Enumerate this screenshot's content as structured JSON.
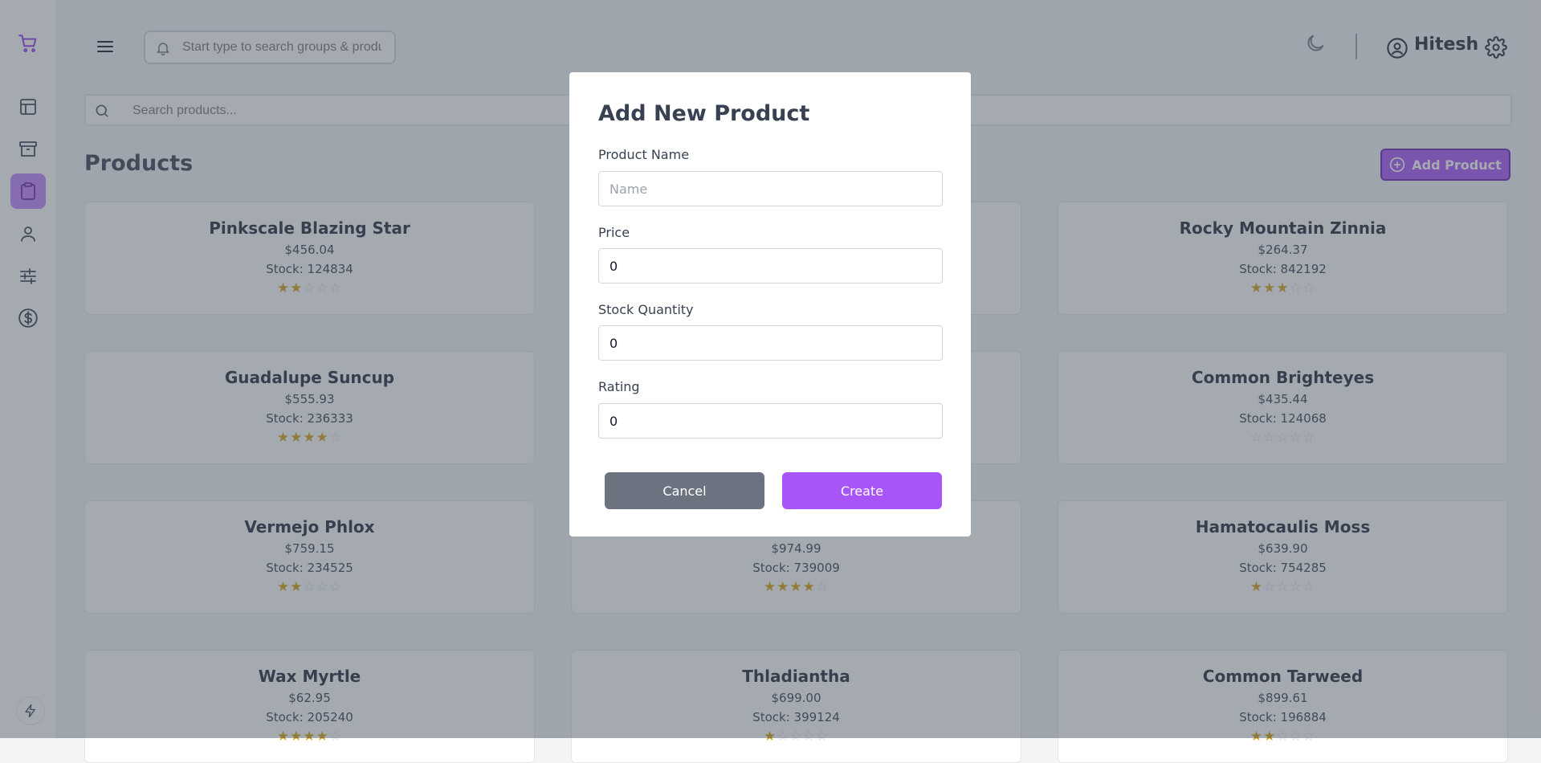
{
  "sidebar": {
    "items": [
      {
        "icon": "shopping-cart-icon"
      },
      {
        "icon": "dashboard-layout-icon"
      },
      {
        "icon": "archive-box-icon"
      },
      {
        "icon": "clipboard-icon"
      },
      {
        "icon": "user-icon"
      },
      {
        "icon": "sliders-icon"
      },
      {
        "icon": "dollar-circle-icon"
      }
    ],
    "bottom_icon": "lightning-icon"
  },
  "header": {
    "search_placeholder": "Start type to search groups & products",
    "username": "Hitesh"
  },
  "products_page": {
    "search_placeholder": "Search products...",
    "title": "Products",
    "add_button_label": "Add Product",
    "products": [
      {
        "name": "Pinkscale Blazing Star",
        "price": "$456.04",
        "stock": "Stock: 124834",
        "rating": 2
      },
      {
        "name": "",
        "price": "",
        "stock": "",
        "rating": 0
      },
      {
        "name": "Rocky Mountain Zinnia",
        "price": "$264.37",
        "stock": "Stock: 842192",
        "rating": 3
      },
      {
        "name": "Guadalupe Suncup",
        "price": "$555.93",
        "stock": "Stock: 236333",
        "rating": 4
      },
      {
        "name": "",
        "price": "",
        "stock": "",
        "rating": 0
      },
      {
        "name": "Common Brighteyes",
        "price": "$435.44",
        "stock": "Stock: 124068",
        "rating": 0
      },
      {
        "name": "Vermejo Phlox",
        "price": "$759.15",
        "stock": "Stock: 234525",
        "rating": 2
      },
      {
        "name": "",
        "price": "$974.99",
        "stock": "Stock: 739009",
        "rating": 4
      },
      {
        "name": "Hamatocaulis Moss",
        "price": "$639.90",
        "stock": "Stock: 754285",
        "rating": 1
      },
      {
        "name": "Wax Myrtle",
        "price": "$62.95",
        "stock": "Stock: 205240",
        "rating": 4
      },
      {
        "name": "Thladiantha",
        "price": "$699.00",
        "stock": "Stock: 399124",
        "rating": 1
      },
      {
        "name": "Common Tarweed",
        "price": "$899.61",
        "stock": "Stock: 196884",
        "rating": 2
      }
    ]
  },
  "modal": {
    "title": "Add New Product",
    "fields": {
      "name": {
        "label": "Product Name",
        "placeholder": "Name",
        "value": ""
      },
      "price": {
        "label": "Price",
        "value": "0"
      },
      "stock": {
        "label": "Stock Quantity",
        "value": "0"
      },
      "rating": {
        "label": "Rating",
        "value": "0"
      }
    },
    "cancel_label": "Cancel",
    "create_label": "Create"
  },
  "colors": {
    "accent": "#a855f7",
    "accent_dark": "#6b21a8",
    "star": "#d4a017",
    "cancel_gray": "#6b7280"
  }
}
